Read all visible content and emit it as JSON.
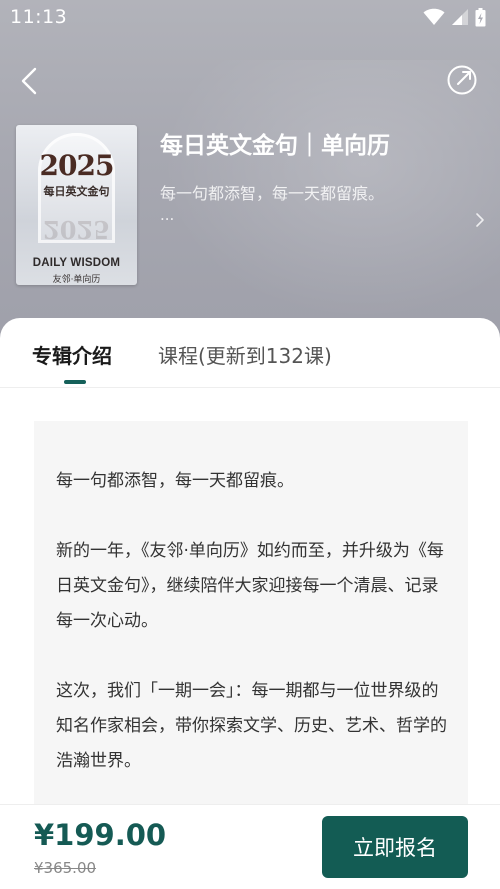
{
  "status_bar": {
    "time": "11:13",
    "icons": [
      "wifi-icon",
      "signal-icon",
      "battery-icon"
    ]
  },
  "nav": {
    "back_icon": "back-icon",
    "share_icon": "share-icon"
  },
  "album": {
    "cover": {
      "year": "2025",
      "subtitle": "每日英文金句",
      "brand": "DAILY WISDOM",
      "brand_sub": "友邻·单向历"
    },
    "title": "每日英文金句｜单向历",
    "description": "每一句都添智，每一天都留痕。",
    "more": "..."
  },
  "tabs": [
    {
      "label": "专辑介绍",
      "active": true
    },
    {
      "label": "课程(更新到132课)",
      "active": false
    }
  ],
  "intro": {
    "paragraphs": [
      "每一句都添智，每一天都留痕。",
      "新的一年，《友邻·单向历》如约而至，并升级为《每日英文金句》，继续陪伴大家迎接每一个清晨、记录每一次心动。",
      "这次，我们「一期一会」：每一期都与一位世界级的知名作家相会，带你探索文学、历史、艺术、哲学的浩瀚世界。"
    ]
  },
  "purchase": {
    "price": "¥199.00",
    "original_price": "¥365.00",
    "button_label": "立即报名"
  },
  "colors": {
    "accent": "#135c54",
    "header_bg": "#a9aab3"
  }
}
